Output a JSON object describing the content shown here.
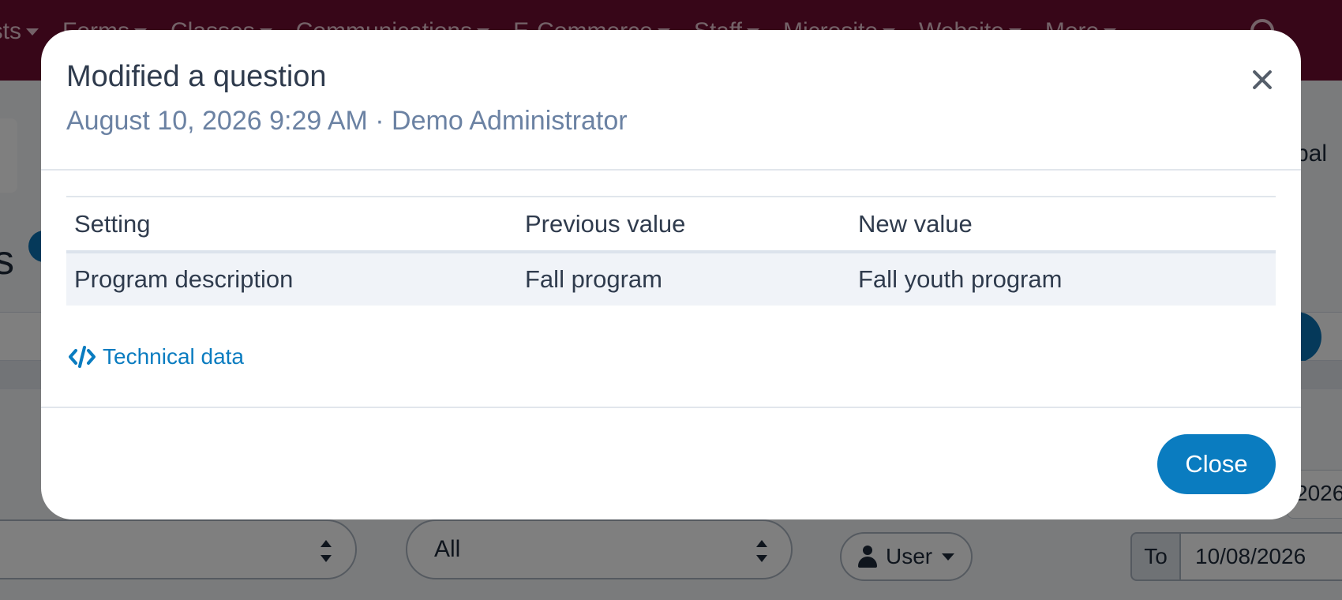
{
  "nav": {
    "items": [
      "ists",
      "Forms",
      "Classes",
      "Communications",
      "E-Commerce",
      "Staff",
      "Microsite",
      "Website",
      "More"
    ]
  },
  "background": {
    "right_text": "l bal",
    "select_all": "All",
    "user_button": "User",
    "to_label": "To",
    "to_date": "10/08/2026",
    "right_date_partial": "2026"
  },
  "modal": {
    "title": "Modified a question",
    "subtitle": "August 10, 2026 9:29 AM · Demo Administrator",
    "table": {
      "headers": [
        "Setting",
        "Previous value",
        "New value"
      ],
      "rows": [
        [
          "Program description",
          "Fall program",
          "Fall youth program"
        ]
      ]
    },
    "technical_link": "Technical data",
    "close_label": "Close"
  },
  "colors": {
    "nav_bg": "#6e0d30",
    "accent": "#0a7cc0",
    "subtitle": "#6b82a3"
  },
  "icons": [
    "search-icon",
    "close-icon",
    "code-icon",
    "user-icon",
    "caret-down-icon"
  ]
}
